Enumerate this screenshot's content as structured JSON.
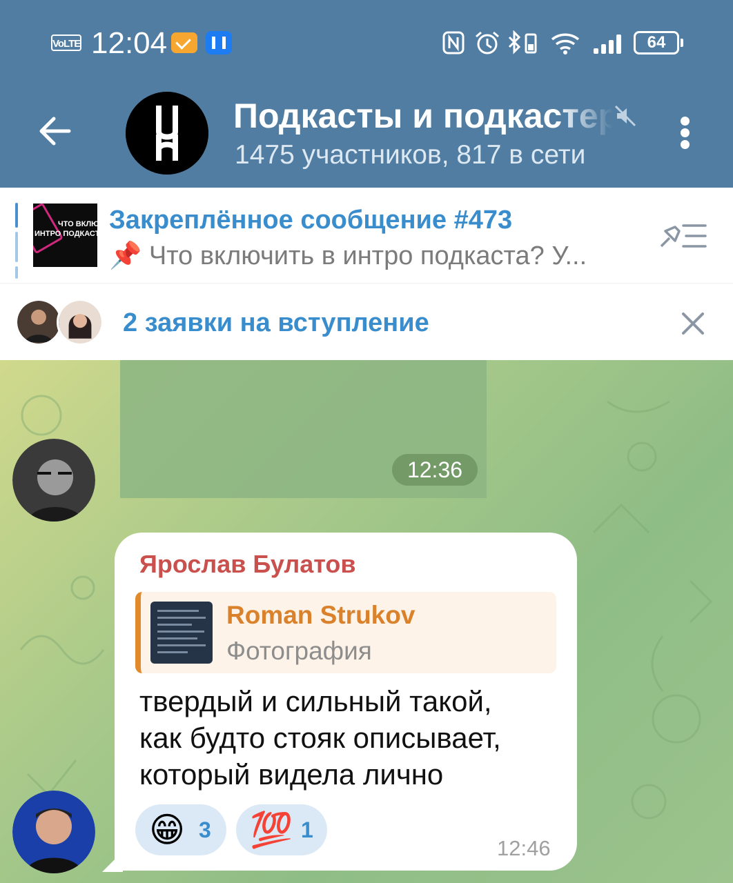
{
  "status_bar": {
    "network_badge": "VoLTE",
    "time": "12:04",
    "battery": "64"
  },
  "header": {
    "title": "Подкасты и подкастеры",
    "subtitle": "1475 участников, 817 в сети"
  },
  "pinned": {
    "title": "Закреплённое сообщение #473",
    "text": "📌 Что включить в интро подкаста?  У...",
    "thumb_line1": "ЧТО ВКЛЮ",
    "thumb_line2": "ИНТРО ПОДКАСТА?"
  },
  "join_requests": {
    "label": "2 заявки на вступление"
  },
  "messages": [
    {
      "type": "photo",
      "time": "12:36"
    },
    {
      "type": "text",
      "sender": "Ярослав Булатов",
      "reply": {
        "author": "Roman Strukov",
        "kind": "Фотография"
      },
      "lines": [
        "твердый и сильный такой,",
        "как будто стояк описывает,",
        "который видела лично"
      ],
      "reactions": [
        {
          "emoji": "😁",
          "count": "3"
        },
        {
          "emoji": "💯",
          "count": "1"
        }
      ],
      "time": "12:46"
    }
  ],
  "colors": {
    "header": "#517da2",
    "accent": "#3a8dcd",
    "sender_name": "#c9504c",
    "reply_author": "#d9822b"
  }
}
